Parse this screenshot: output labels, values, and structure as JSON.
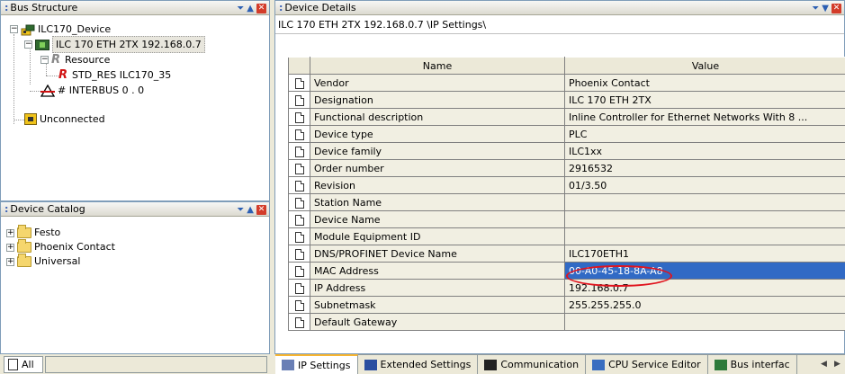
{
  "bus_structure": {
    "title": "Bus Structure",
    "items": [
      {
        "label": "ILC170_Device",
        "icon": "device-icon"
      },
      {
        "label": "ILC 170 ETH 2TX 192.168.0.7",
        "icon": "module-icon"
      },
      {
        "label": "Resource",
        "icon": "resource-icon"
      },
      {
        "label": "STD_RES ILC170_35",
        "icon": "std-res-icon"
      },
      {
        "label": "# INTERBUS 0 . 0",
        "icon": "interbus-icon"
      },
      {
        "label": "Unconnected",
        "icon": "unconnected-icon"
      }
    ]
  },
  "device_catalog": {
    "title": "Device Catalog",
    "items": [
      {
        "label": "Festo"
      },
      {
        "label": "Phoenix Contact"
      },
      {
        "label": "Universal"
      }
    ],
    "tab_label": "All"
  },
  "device_details": {
    "title": "Device Details",
    "path": "ILC 170 ETH 2TX 192.168.0.7 \\IP Settings\\",
    "columns": {
      "name": "Name",
      "value": "Value"
    },
    "rows": [
      {
        "name": "Vendor",
        "value": "Phoenix Contact"
      },
      {
        "name": "Designation",
        "value": "ILC 170 ETH 2TX"
      },
      {
        "name": "Functional description",
        "value": "Inline Controller for Ethernet Networks With 8 ..."
      },
      {
        "name": "Device type",
        "value": "PLC"
      },
      {
        "name": "Device family",
        "value": "ILC1xx"
      },
      {
        "name": "Order number",
        "value": "2916532"
      },
      {
        "name": "Revision",
        "value": "01/3.50"
      },
      {
        "name": "Station Name",
        "value": ""
      },
      {
        "name": "Device Name",
        "value": ""
      },
      {
        "name": "Module Equipment ID",
        "value": ""
      },
      {
        "name": "DNS/PROFINET Device Name",
        "value": "ILC170ETH1"
      },
      {
        "name": "MAC Address",
        "value": "00-A0-45-18-8A-A8"
      },
      {
        "name": "IP Address",
        "value": "192.168.0.7"
      },
      {
        "name": "Subnetmask",
        "value": "255.255.255.0"
      },
      {
        "name": "Default Gateway",
        "value": ""
      }
    ],
    "tabs": [
      {
        "label": "IP Settings"
      },
      {
        "label": "Extended Settings"
      },
      {
        "label": "Communication"
      },
      {
        "label": "CPU Service Editor"
      },
      {
        "label": "Bus interfac"
      }
    ]
  },
  "colors": {
    "selection": "#316ac5",
    "highlight_ellipse": "#e0141e",
    "active_tab": "#f7b531"
  }
}
